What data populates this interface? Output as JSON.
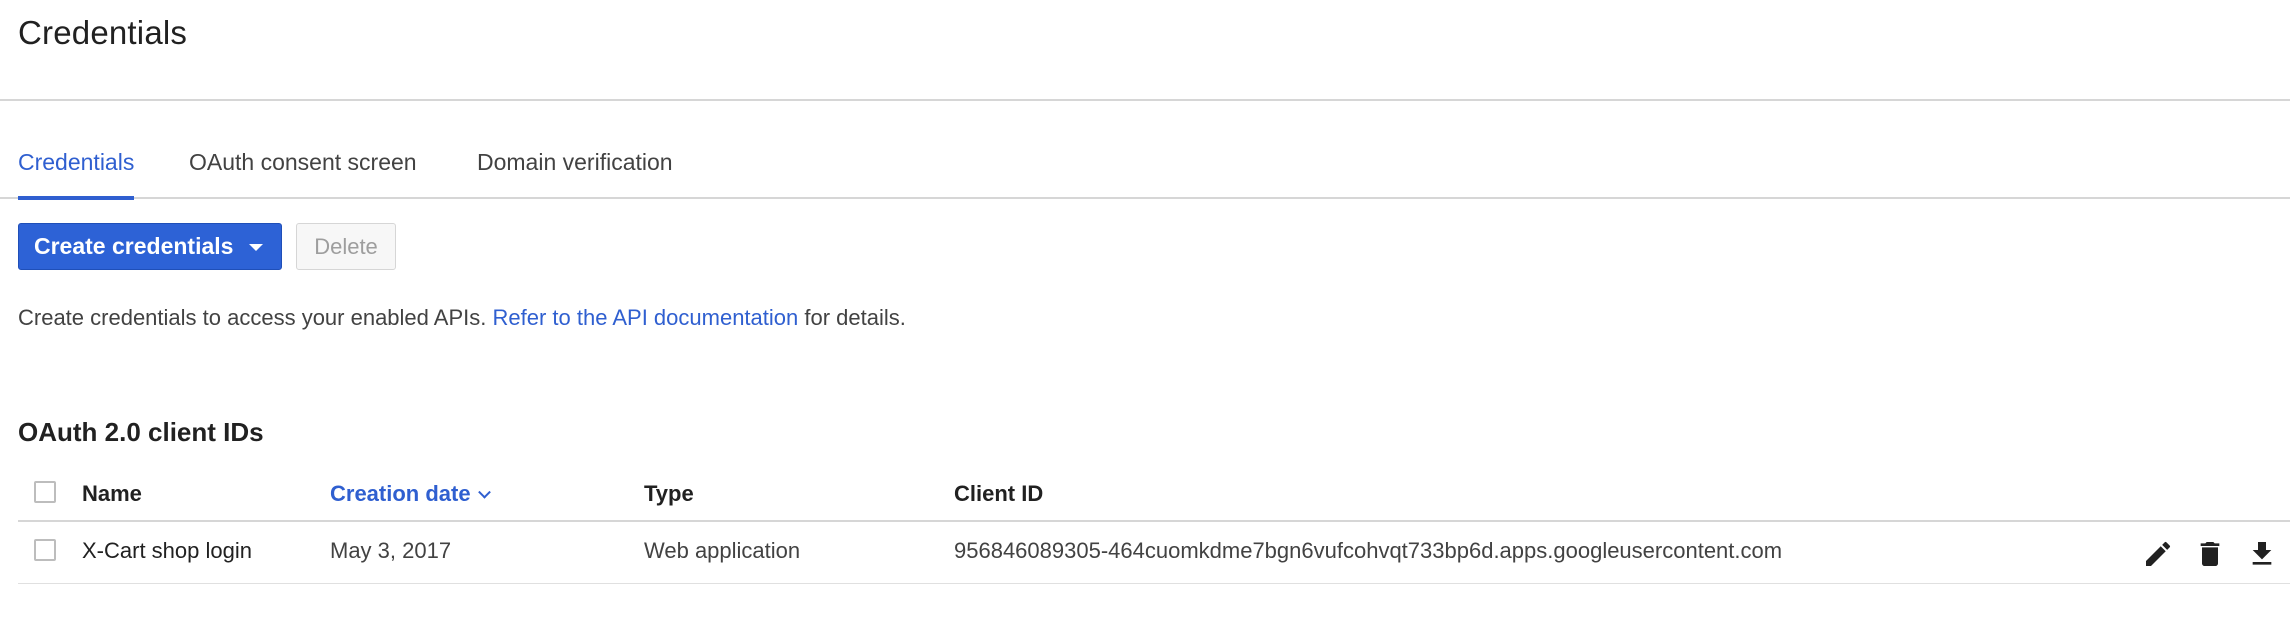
{
  "header": {
    "title": "Credentials"
  },
  "tabs": [
    {
      "label": "Credentials",
      "active": true
    },
    {
      "label": "OAuth consent screen",
      "active": false
    },
    {
      "label": "Domain verification",
      "active": false
    }
  ],
  "toolbar": {
    "create_label": "Create credentials",
    "delete_label": "Delete"
  },
  "info": {
    "prefix": "Create credentials to access your enabled APIs.",
    "link": "Refer to the API documentation",
    "suffix": "for details."
  },
  "section": {
    "title": "OAuth 2.0 client IDs"
  },
  "table": {
    "columns": [
      "Name",
      "Creation date",
      "Type",
      "Client ID"
    ],
    "sorted_column": "Creation date",
    "rows": [
      {
        "name": "X-Cart shop login",
        "creation_date": "May 3, 2017",
        "type": "Web application",
        "client_id": "956846089305-464cuomkdme7bgn6vufcohvqt733bp6d.apps.googleusercontent.com"
      }
    ]
  },
  "icons": {
    "edit": "pencil-icon",
    "delete": "trash-icon",
    "download": "download-icon",
    "dropdown": "caret-down-icon",
    "sort": "chevron-down-icon"
  },
  "colors": {
    "accent": "#2d62d6",
    "link": "#2f5fd0",
    "divider": "#d6d6d6"
  }
}
